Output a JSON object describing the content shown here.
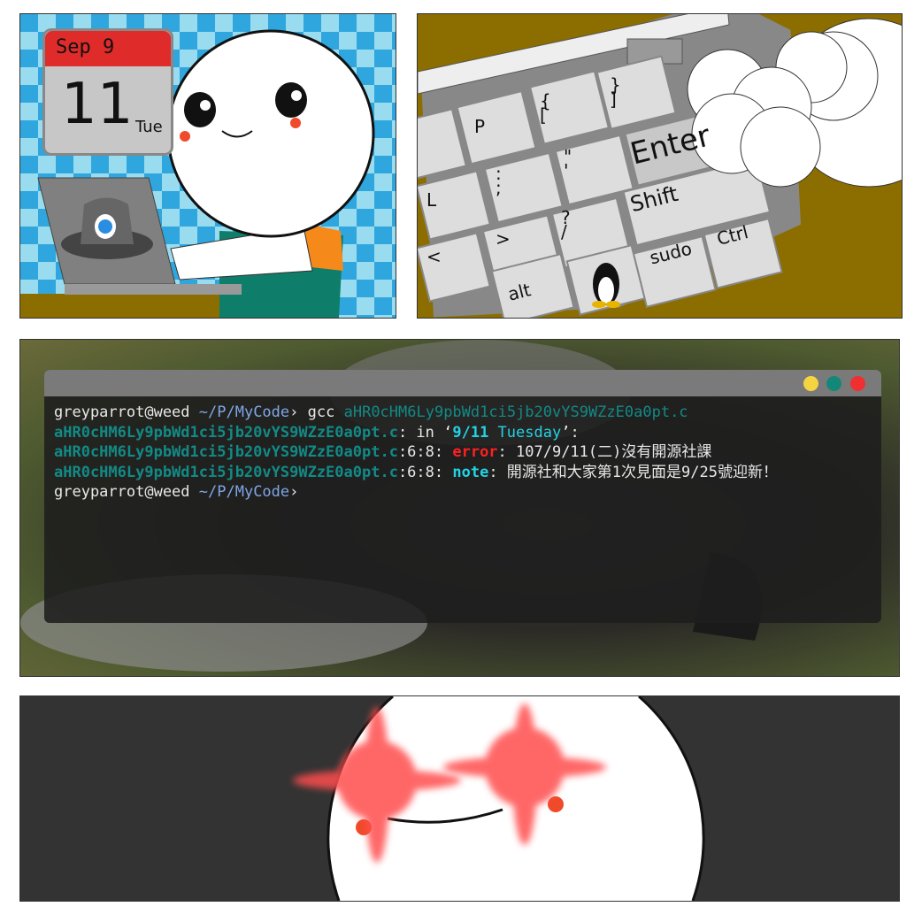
{
  "calendar": {
    "month_day": "Sep 9",
    "date": "11",
    "weekday": "Tue"
  },
  "keyboard": {
    "keys": [
      "P",
      "{\n[",
      "}\n]",
      "Enter",
      "L",
      ":\n;",
      "\"\n'",
      "Shift",
      "<",
      ">",
      "?\n/",
      "sudo",
      "Ctrl",
      "alt"
    ]
  },
  "terminal": {
    "colors": {
      "close": "#f03030",
      "maximize": "#138878",
      "minimize": "#f5d442"
    },
    "line1": {
      "prompt_user": "greyparrot@weed",
      "prompt_path": "~/P/MyCode",
      "prompt_sym": "›",
      "command": "gcc",
      "file": "aHR0cHM6Ly9pbWd1ci5jb20vYS9WZzE0a0pt.c"
    },
    "line2": {
      "file": "aHR0cHM6Ly9pbWd1ci5jb20vYS9WZzE0a0pt.c",
      "in": ": in ‘",
      "date": "9/11",
      "day": " Tuesday",
      "end": "’:"
    },
    "line3": {
      "file": "aHR0cHM6Ly9pbWd1ci5jb20vYS9WZzE0a0pt.c",
      "pos": ":6:8: ",
      "label": "error",
      "msg": ": 107/9/11(二)沒有開源社課"
    },
    "line4": {
      "file": "aHR0cHM6Ly9pbWd1ci5jb20vYS9WZzE0a0pt.c",
      "pos": ":6:8: ",
      "label": "note",
      "msg": ": 開源社和大家第1次見面是9/25號迎新！"
    },
    "line5": {
      "prompt_user": "greyparrot@weed",
      "prompt_path": "~/P/MyCode",
      "prompt_sym": "›"
    }
  }
}
